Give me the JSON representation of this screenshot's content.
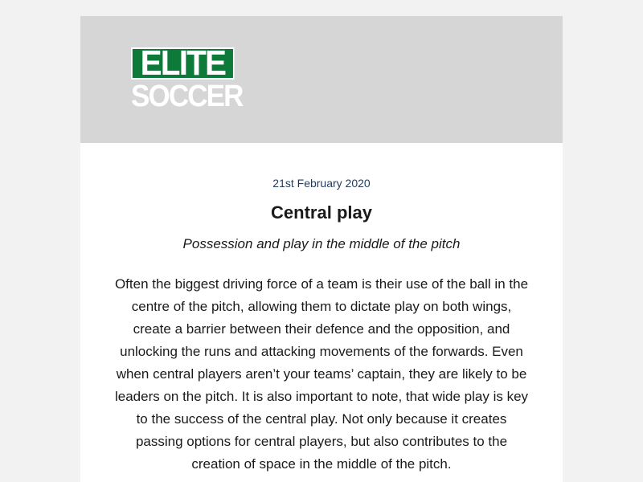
{
  "brand": {
    "logo_top": "ELITE",
    "logo_bottom": "SOCCER",
    "accent_color": "#0d7a3a"
  },
  "article": {
    "date": "21st February 2020",
    "title": "Central play",
    "subtitle": "Possession and play in the middle of the pitch",
    "body": "Often the biggest driving force of a team is their use of the ball in the centre of the pitch, allowing them to dictate play on both wings, create a barrier between their defence and the opposition, and unlocking the runs and attacking movements of the forwards. Even when central players aren’t your teams’ captain, they are likely to be leaders on the pitch. It is also important to note, that wide play is key to the success of the central play. Not only because it creates passing options for central players, but also contributes to the creation of space in the middle of the pitch."
  }
}
